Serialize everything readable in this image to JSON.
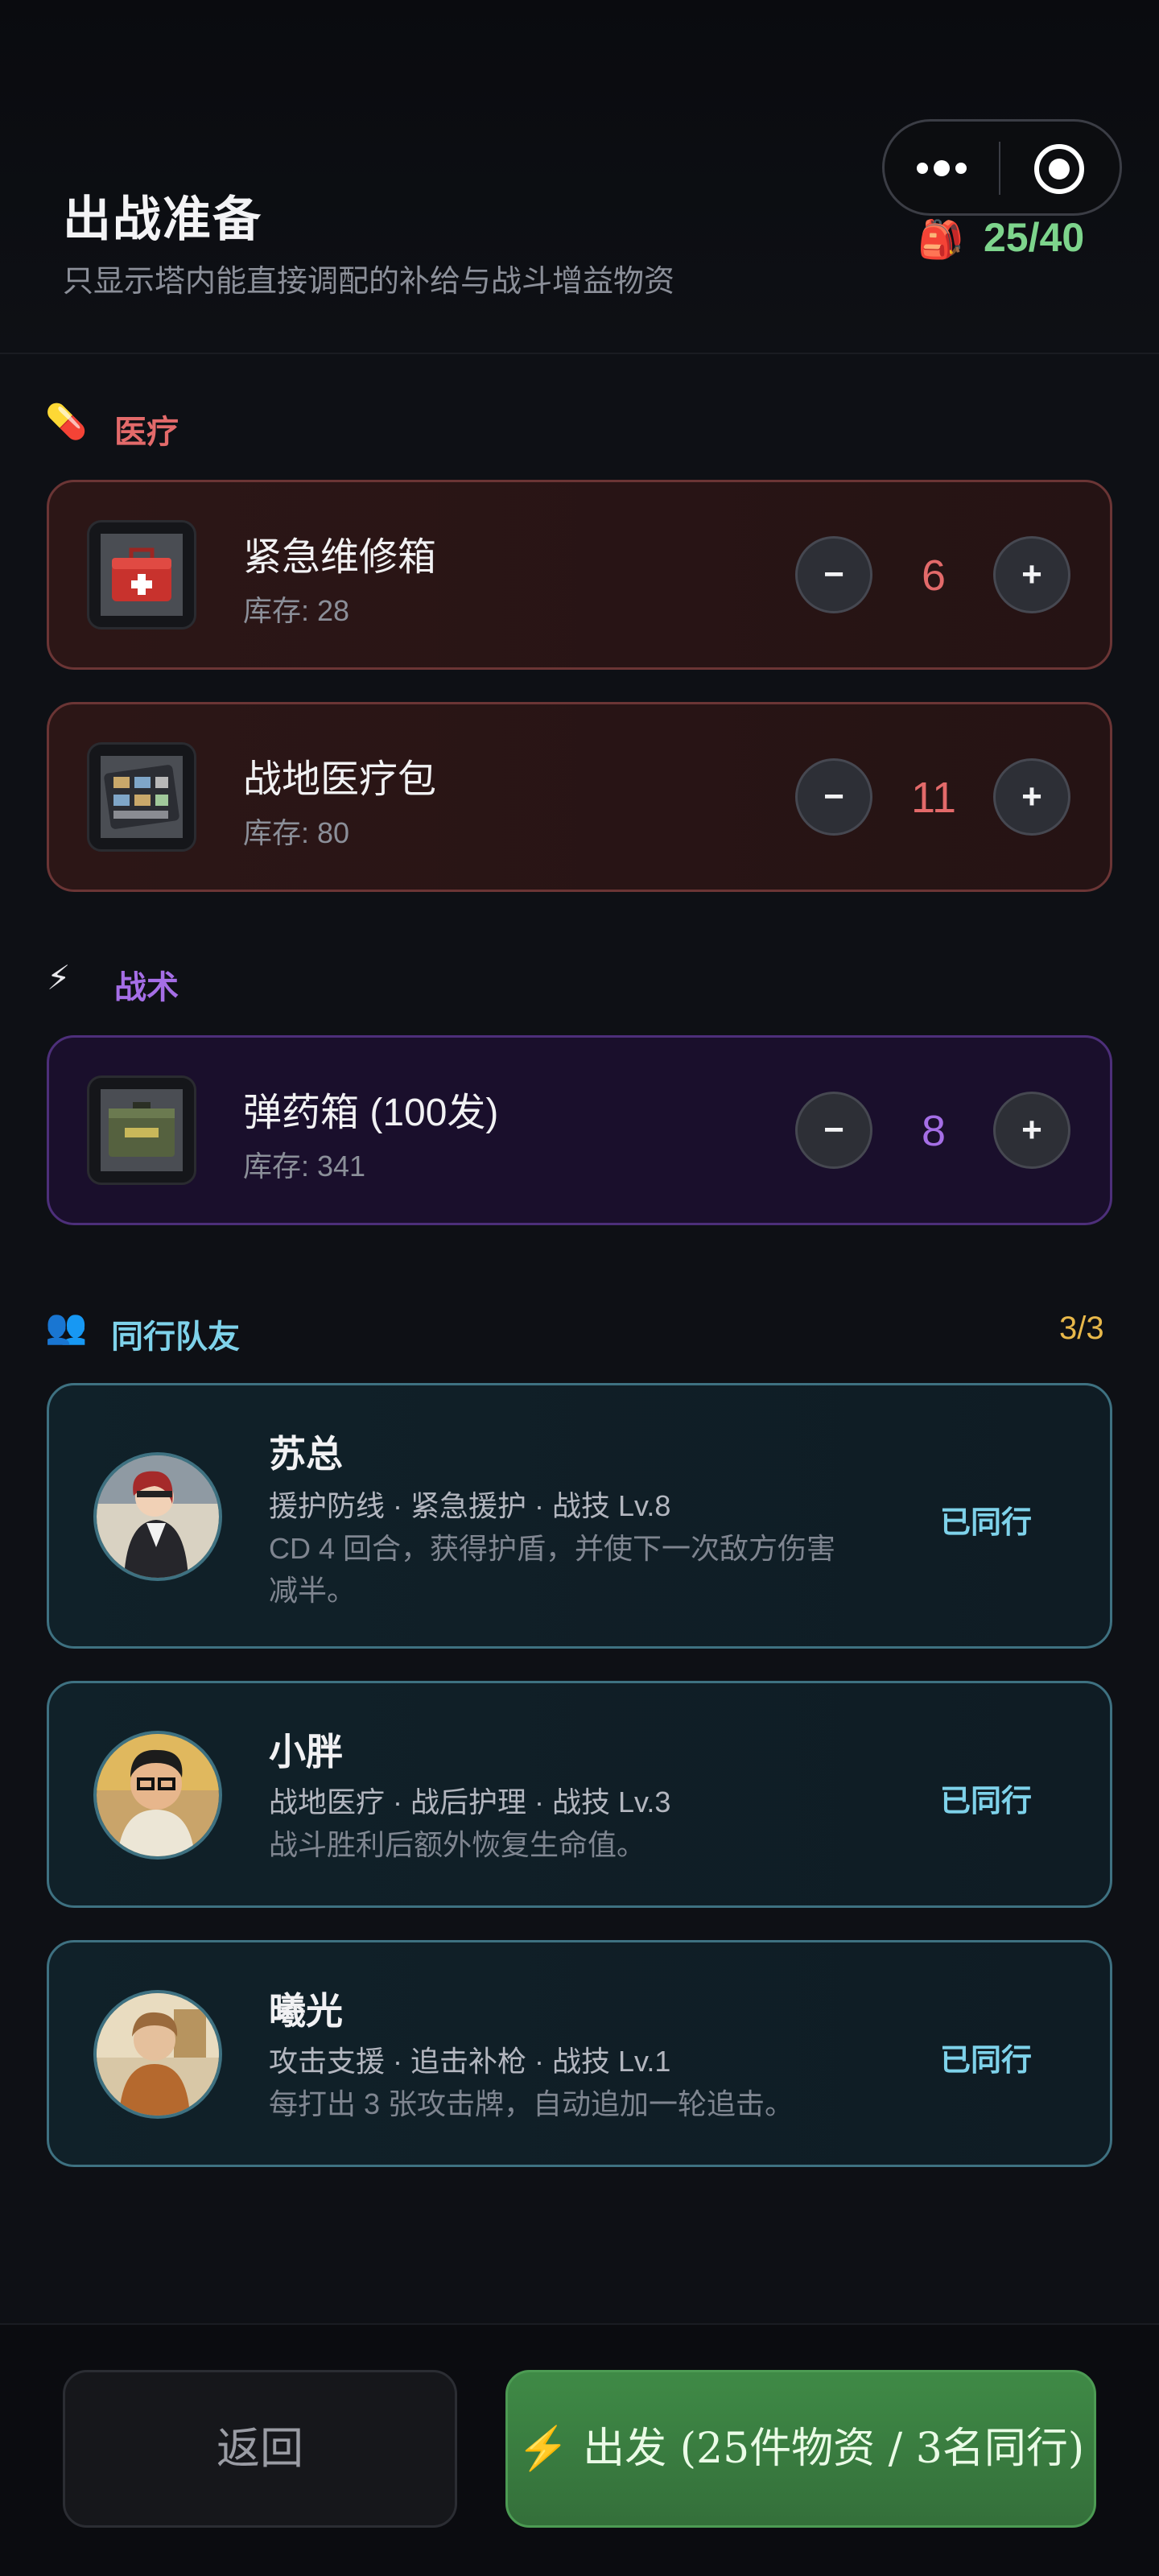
{
  "header": {
    "title": "出战准备",
    "subtitle": "只显示塔内能直接调配的补给与战斗增益物资",
    "capacity": "25/40"
  },
  "sections": {
    "medical": {
      "icon": "pill-icon",
      "label": "医疗",
      "color": "#e36a6a",
      "items": [
        {
          "name": "紧急维修箱",
          "stock": "库存: 28",
          "qty": "6",
          "icon": "repair-kit-icon"
        },
        {
          "name": "战地医疗包",
          "stock": "库存: 80",
          "qty": "11",
          "icon": "medical-pack-icon"
        }
      ]
    },
    "tactics": {
      "icon": "lightning-icon",
      "label": "战术",
      "color": "#a56ee6",
      "items": [
        {
          "name": "弹药箱 (100发)",
          "stock": "库存: 341",
          "qty": "8",
          "icon": "ammo-box-icon"
        }
      ]
    },
    "teammates": {
      "icon": "people-icon",
      "label": "同行队友",
      "count": "3/3",
      "color": "#7ed2ea",
      "members": [
        {
          "name": "苏总",
          "tags": "援护防线 · 紧急援护 · 战技 Lv.8",
          "desc": "CD 4 回合，获得护盾，并使下一次敌方伤害减半。",
          "status": "已同行"
        },
        {
          "name": "小胖",
          "tags": "战地医疗 · 战后护理 · 战技 Lv.3",
          "desc": "战斗胜利后额外恢复生命值。",
          "status": "已同行"
        },
        {
          "name": "曦光",
          "tags": "攻击支援 · 追击补枪 · 战技 Lv.1",
          "desc": "每打出 3 张攻击牌，自动追加一轮追击。",
          "status": "已同行"
        }
      ]
    }
  },
  "footer": {
    "back_label": "返回",
    "depart_label": "⚡ 出发 (25件物资 / 3名同行)"
  },
  "stepper": {
    "minus": "−",
    "plus": "+"
  }
}
